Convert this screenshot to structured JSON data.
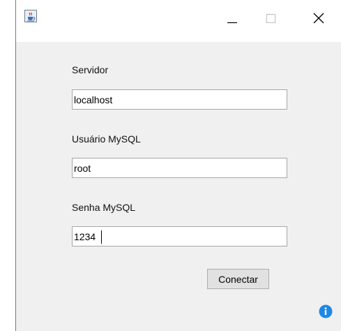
{
  "window": {
    "title_icon": "java-cup-icon",
    "controls": {
      "minimize_icon": "minimize-icon",
      "maximize_icon": "maximize-icon",
      "close_icon": "close-icon"
    }
  },
  "form": {
    "server_label": "Servidor",
    "server_value": "localhost",
    "user_label": "Usuário MySQL",
    "user_value": "root",
    "password_label": "Senha MySQL",
    "password_value": "1234",
    "connect_button": "Conectar"
  },
  "status": {
    "info_icon": "info-icon",
    "accent_color": "#1e88e5"
  }
}
